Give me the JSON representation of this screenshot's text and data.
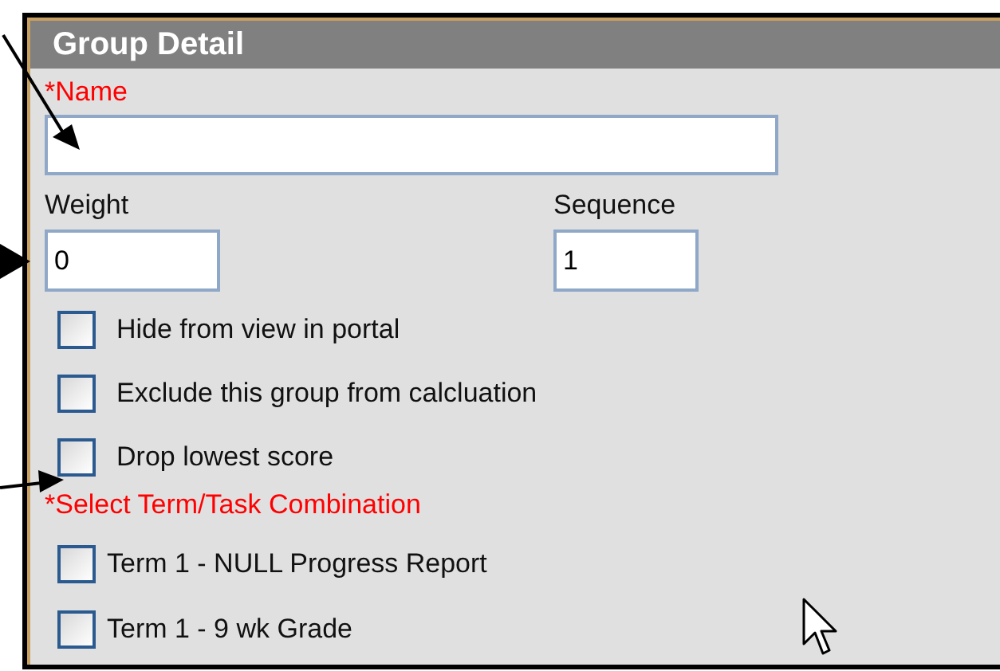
{
  "panel": {
    "title": "Group Detail"
  },
  "name_field": {
    "label": "*Name",
    "required": true
  },
  "weight_field": {
    "label": "Weight",
    "required": false,
    "value": "0"
  },
  "sequence_field": {
    "label": "Sequence",
    "required": false,
    "value": "1"
  },
  "options": [
    {
      "label": "Hide from view in portal",
      "checked": false
    },
    {
      "label": "Exclude this group from calcluation",
      "checked": false
    },
    {
      "label": "Drop lowest score",
      "checked": false
    }
  ],
  "term_section": {
    "label": "*Select Term/Task Combination",
    "required": true
  },
  "terms": [
    {
      "label": "Term 1 - NULL Progress Report",
      "checked": false
    },
    {
      "label": "Term 1 - 9 wk Grade",
      "checked": false
    }
  ]
}
